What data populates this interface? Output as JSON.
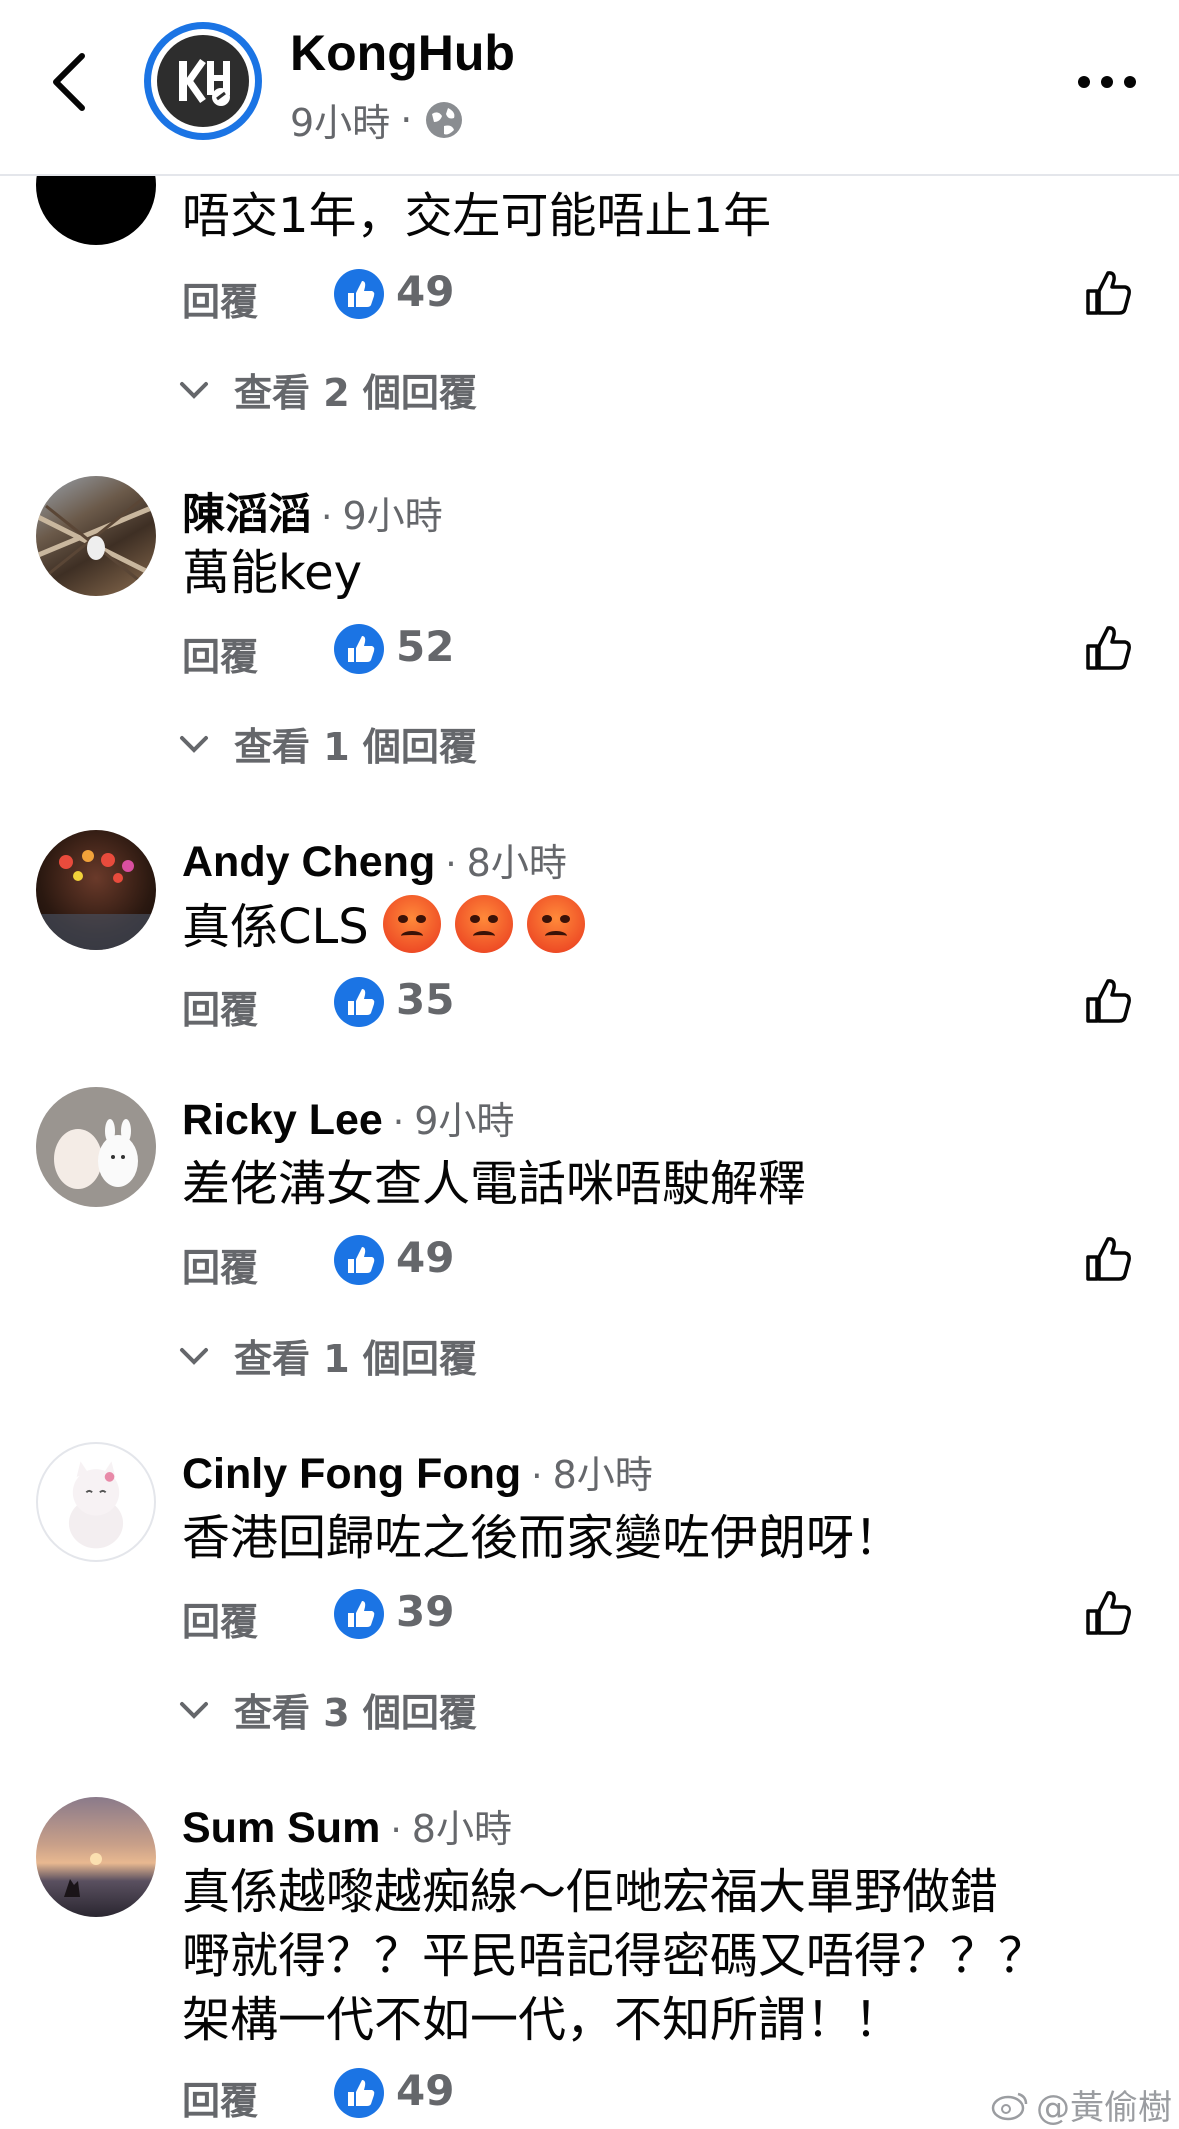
{
  "header": {
    "page_name": "KongHub",
    "post_time": "9小時",
    "separator": "·"
  },
  "comments": [
    {
      "author": "",
      "time": "",
      "text": "唔交1年，交左可能唔止1年",
      "reply_label": "回覆",
      "likes": "49",
      "view_replies": "查看 2 個回覆"
    },
    {
      "author": "陳滔滔",
      "time": "9小時",
      "text": "萬能key",
      "reply_label": "回覆",
      "likes": "52",
      "view_replies": "查看 1 個回覆"
    },
    {
      "author": "Andy Cheng",
      "time": "8小時",
      "text": "真係CLS",
      "reply_label": "回覆",
      "likes": "35"
    },
    {
      "author": "Ricky Lee",
      "time": "9小時",
      "text": "差佬溝女查人電話咪唔駛解釋",
      "reply_label": "回覆",
      "likes": "49",
      "view_replies": "查看 1 個回覆"
    },
    {
      "author": "Cinly Fong Fong",
      "time": "8小時",
      "text": "香港回歸咗之後而家變咗伊朗呀！",
      "reply_label": "回覆",
      "likes": "39",
      "view_replies": "查看 3 個回覆"
    },
    {
      "author": "Sum Sum",
      "time": "8小時",
      "text_lines": [
        "真係越嚟越痴線～佢哋宏福大單野做錯",
        "嘢就得？？平民唔記得密碼又唔得？？？",
        "架構一代不如一代，不知所謂！！"
      ],
      "reply_label": "回覆",
      "likes": "49"
    }
  ],
  "watermark": "@黃偷樹",
  "colors": {
    "accent": "#1b74e4",
    "secondary_text": "#65676b",
    "primary_text": "#050505"
  }
}
